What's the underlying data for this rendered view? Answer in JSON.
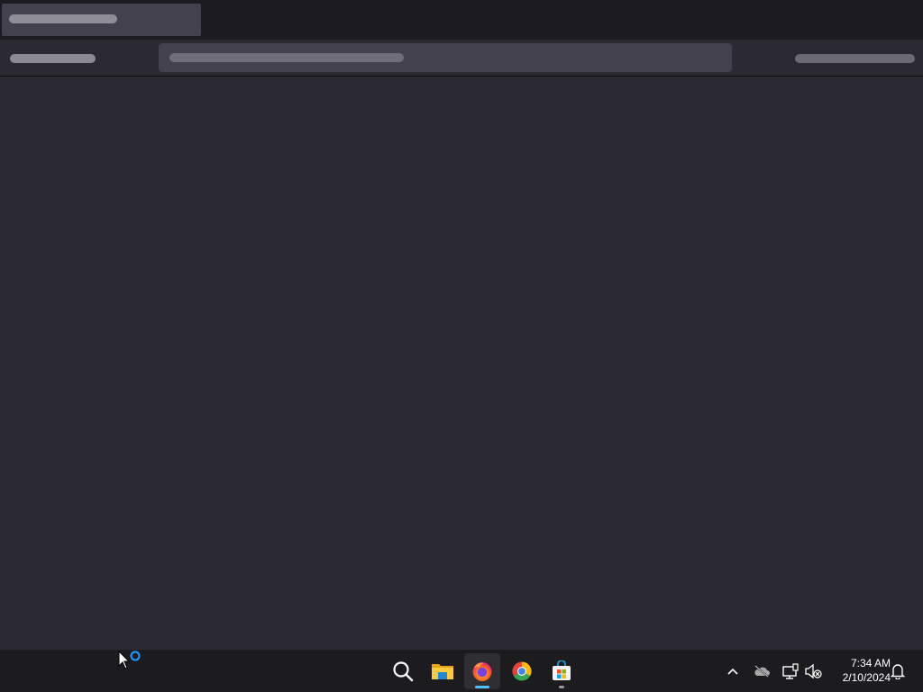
{
  "taskbar": {
    "apps": [
      {
        "name": "Search",
        "icon": "search-icon"
      },
      {
        "name": "File Explorer",
        "icon": "folder-icon"
      },
      {
        "name": "Firefox",
        "icon": "firefox-icon",
        "active": true
      },
      {
        "name": "Google Chrome",
        "icon": "chrome-icon"
      },
      {
        "name": "Microsoft Store",
        "icon": "store-icon"
      }
    ],
    "tray": {
      "icons": [
        "chevron-up-icon",
        "onedrive-offline-icon",
        "network-icon",
        "volume-muted-icon",
        "notification-bell-icon"
      ]
    },
    "clock": {
      "time": "7:34 AM",
      "date": "2/10/2024"
    }
  },
  "colors": {
    "tab_strip": "#1c1b22",
    "toolbar": "#2b2a33",
    "content": "#2b2a33",
    "taskbar": "#1c1c1f",
    "accent": "#4cc2ff"
  }
}
